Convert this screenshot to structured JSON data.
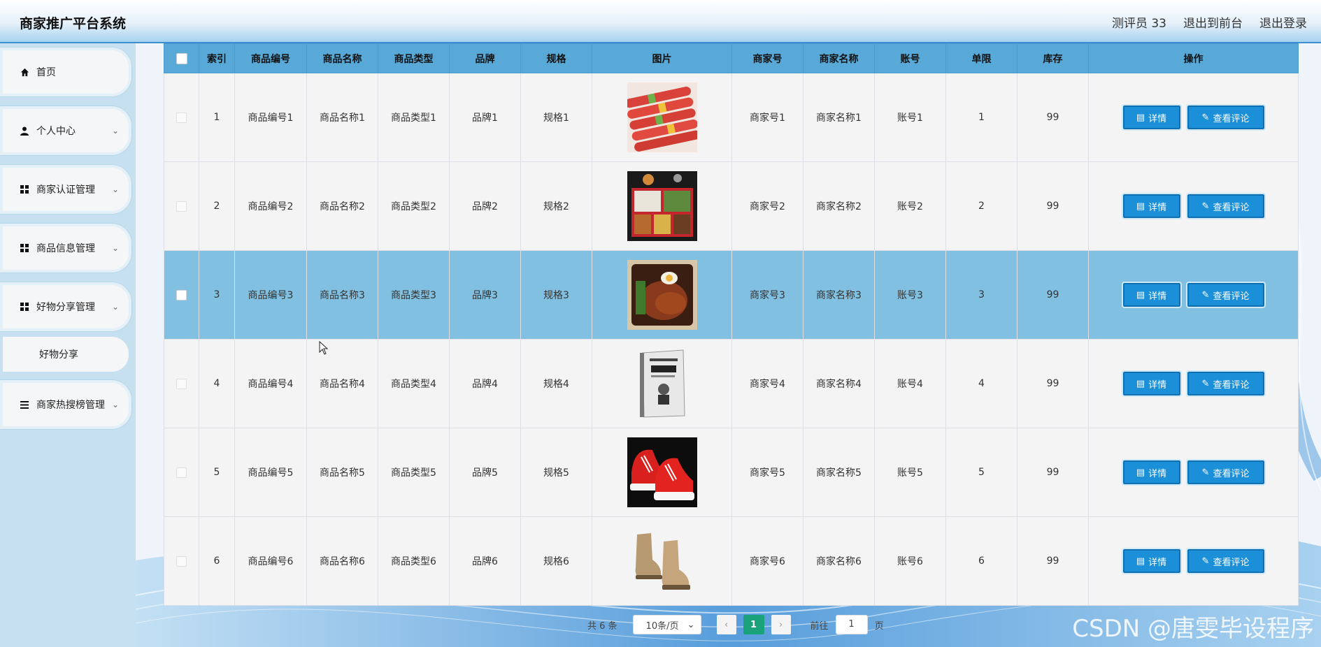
{
  "header": {
    "title": "商家推广平台系统",
    "user": "测评员 33",
    "to_front": "退出到前台",
    "logout": "退出登录"
  },
  "sidebar": {
    "items": [
      {
        "label": "首页",
        "icon": "home-icon",
        "expandable": false
      },
      {
        "label": "个人中心",
        "icon": "user-icon",
        "expandable": true
      },
      {
        "label": "商家认证管理",
        "icon": "grid-icon",
        "expandable": true
      },
      {
        "label": "商品信息管理",
        "icon": "grid-icon",
        "expandable": true
      },
      {
        "label": "好物分享管理",
        "icon": "grid-icon",
        "expandable": true
      },
      {
        "label": "商家热搜榜管理",
        "icon": "list-icon",
        "expandable": true
      }
    ],
    "subitem": "好物分享"
  },
  "table": {
    "columns": [
      "",
      "索引",
      "商品编号",
      "商品名称",
      "商品类型",
      "品牌",
      "规格",
      "图片",
      "商家号",
      "商家名称",
      "账号",
      "单限",
      "库存",
      "操作"
    ],
    "rows": [
      {
        "index": "1",
        "code": "商品编号1",
        "name": "商品名称1",
        "type": "商品类型1",
        "brand": "品牌1",
        "spec": "规格1",
        "image": "sausages",
        "merchant_no": "商家号1",
        "merchant_name": "商家名称1",
        "account": "账号1",
        "limit": "1",
        "stock": "99"
      },
      {
        "index": "2",
        "code": "商品编号2",
        "name": "商品名称2",
        "type": "商品类型2",
        "brand": "品牌2",
        "spec": "规格2",
        "image": "bento-box",
        "merchant_no": "商家号2",
        "merchant_name": "商家名称2",
        "account": "账号2",
        "limit": "2",
        "stock": "99"
      },
      {
        "index": "3",
        "code": "商品编号3",
        "name": "商品名称3",
        "type": "商品类型3",
        "brand": "品牌3",
        "spec": "规格3",
        "image": "rice-meal",
        "merchant_no": "商家号3",
        "merchant_name": "商家名称3",
        "account": "账号3",
        "limit": "3",
        "stock": "99"
      },
      {
        "index": "4",
        "code": "商品编号4",
        "name": "商品名称4",
        "type": "商品类型4",
        "brand": "品牌4",
        "spec": "规格4",
        "image": "book",
        "merchant_no": "商家号4",
        "merchant_name": "商家名称4",
        "account": "账号4",
        "limit": "4",
        "stock": "99"
      },
      {
        "index": "5",
        "code": "商品编号5",
        "name": "商品名称5",
        "type": "商品类型5",
        "brand": "品牌5",
        "spec": "规格5",
        "image": "red-sneakers",
        "merchant_no": "商家号5",
        "merchant_name": "商家名称5",
        "account": "账号5",
        "limit": "5",
        "stock": "99"
      },
      {
        "index": "6",
        "code": "商品编号6",
        "name": "商品名称6",
        "type": "商品类型6",
        "brand": "品牌6",
        "spec": "规格6",
        "image": "boots",
        "merchant_no": "商家号6",
        "merchant_name": "商家名称6",
        "account": "账号6",
        "limit": "6",
        "stock": "99"
      }
    ],
    "highlighted_row": 3,
    "actions": {
      "detail": "详情",
      "review": "查看评论"
    }
  },
  "pagination": {
    "total": "共 6 条",
    "page_size": "10条/页",
    "current_page": "1",
    "goto_label": "前往",
    "goto_value": "1",
    "page_unit": "页"
  },
  "watermark": "CSDN @唐雯毕设程序",
  "colors": {
    "header_accent": "#3b8fd0",
    "table_header": "#58a9d7",
    "row_highlight": "#82c0e1",
    "button": "#1b8fd8",
    "page_active": "#1aa37a"
  }
}
